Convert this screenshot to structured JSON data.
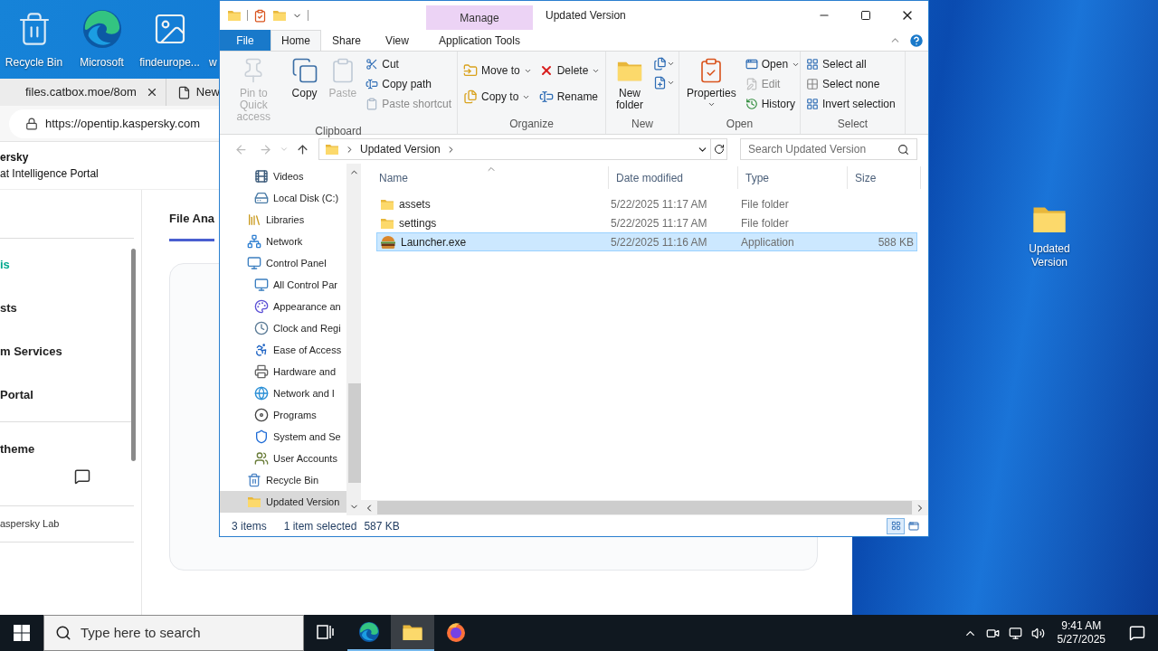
{
  "desktop_icons": [
    {
      "label": "Recycle Bin",
      "kind": "recycle"
    },
    {
      "label": "Microsoft",
      "kind": "edge"
    },
    {
      "label": "findeurope...",
      "kind": "image"
    },
    {
      "label": "w",
      "kind": "hidden"
    }
  ],
  "desktop_icons_right": [
    {
      "label": "Updated Version",
      "kind": "folder"
    }
  ],
  "browser": {
    "tabs": [
      {
        "label": "files.catbox.moe/8om",
        "kind": "page"
      },
      {
        "label": "New",
        "kind": "new"
      }
    ],
    "address": "https://opentip.kaspersky.com",
    "brand": "ersky",
    "subtitle": "at Intelligence Portal",
    "sidebar": [
      {
        "label": "is",
        "selected": true
      },
      {
        "label": "sts",
        "selected": false
      },
      {
        "label": "m Services",
        "selected": false
      },
      {
        "label": "Portal",
        "selected": false
      }
    ],
    "theme_label": "theme",
    "footer": "aspersky Lab",
    "page_tab": "File Ana"
  },
  "explorer": {
    "title": "Updated Version",
    "contextual": {
      "group": "Manage",
      "tab": "Application Tools"
    },
    "tabs": [
      {
        "label": "File",
        "kind": "file",
        "selected": false
      },
      {
        "label": "Home",
        "kind": "tab",
        "selected": true
      },
      {
        "label": "Share",
        "kind": "tab",
        "selected": false
      },
      {
        "label": "View",
        "kind": "tab",
        "selected": false
      }
    ],
    "ribbon": [
      {
        "label": "Clipboard",
        "commands": [
          {
            "label": "Pin to Quick access",
            "disabled": true
          },
          {
            "label": "Copy",
            "disabled": false
          },
          {
            "label": "Paste",
            "disabled": true
          },
          {
            "label": "Cut",
            "disabled": false
          },
          {
            "label": "Copy path",
            "disabled": false
          },
          {
            "label": "Paste shortcut",
            "disabled": true
          }
        ]
      },
      {
        "label": "Organize",
        "commands": [
          {
            "label": "Move to",
            "disabled": false
          },
          {
            "label": "Copy to",
            "disabled": false
          },
          {
            "label": "Delete",
            "disabled": false
          },
          {
            "label": "Rename",
            "disabled": false
          }
        ]
      },
      {
        "label": "New",
        "commands": [
          {
            "label": "New folder",
            "disabled": false
          }
        ]
      },
      {
        "label": "Open",
        "commands": [
          {
            "label": "Properties",
            "disabled": false
          },
          {
            "label": "Open",
            "disabled": false
          },
          {
            "label": "Edit",
            "disabled": true
          },
          {
            "label": "History",
            "disabled": false
          }
        ]
      },
      {
        "label": "Select",
        "commands": [
          {
            "label": "Select all",
            "disabled": false
          },
          {
            "label": "Select none",
            "disabled": false
          },
          {
            "label": "Invert selection",
            "disabled": false
          }
        ]
      }
    ],
    "path": [
      "Updated Version"
    ],
    "search_placeholder": "Search Updated Version",
    "nav_pane": {
      "scrolled_children": [
        {
          "label": "Videos",
          "kind": "videos",
          "selected": false
        },
        {
          "label": "Local Disk (C:)",
          "kind": "disk",
          "selected": false
        }
      ],
      "items": [
        {
          "label": "Libraries",
          "kind": "library",
          "selected": false
        },
        {
          "label": "Network",
          "kind": "network",
          "selected": false
        },
        {
          "label": "Control Panel",
          "kind": "control",
          "selected": false,
          "children": [
            {
              "label": "All Control Par",
              "kind": "control",
              "selected": false
            },
            {
              "label": "Appearance an",
              "kind": "appearance",
              "selected": false
            },
            {
              "label": "Clock and Regi",
              "kind": "clock",
              "selected": false
            },
            {
              "label": "Ease of Access",
              "kind": "access",
              "selected": false
            },
            {
              "label": "Hardware and",
              "kind": "hardware",
              "selected": false
            },
            {
              "label": "Network and I",
              "kind": "netcenter",
              "selected": false
            },
            {
              "label": "Programs",
              "kind": "programs",
              "selected": false
            },
            {
              "label": "System and Se",
              "kind": "system",
              "selected": false
            },
            {
              "label": "User Accounts",
              "kind": "users",
              "selected": false
            }
          ]
        },
        {
          "label": "Recycle Bin",
          "kind": "recycle",
          "selected": false
        },
        {
          "label": "Updated Version",
          "kind": "folder",
          "selected": true
        }
      ]
    },
    "columns": [
      "Name",
      "Date modified",
      "Type",
      "Size"
    ],
    "rows": [
      {
        "name": "assets",
        "date": "5/22/2025 11:17 AM",
        "type": "File folder",
        "kind": "folder",
        "selected": false
      },
      {
        "name": "settings",
        "date": "5/22/2025 11:17 AM",
        "type": "File folder",
        "kind": "folder",
        "selected": false
      },
      {
        "name": "Launcher.exe",
        "date": "5/22/2025 11:16 AM",
        "type": "Application",
        "size": "588 KB",
        "kind": "app",
        "selected": true
      }
    ],
    "status": {
      "count": "3 items",
      "selection": "1 item selected",
      "selection_size": "587 KB"
    }
  },
  "taskbar": {
    "search_placeholder": "Type here to search",
    "apps": [
      {
        "kind": "taskview",
        "selected": false,
        "running": false
      },
      {
        "kind": "edge",
        "selected": false,
        "running": true
      },
      {
        "kind": "explorer",
        "selected": true,
        "running": true
      },
      {
        "kind": "firefox",
        "selected": false,
        "running": false
      }
    ],
    "time": "9:41 AM",
    "date": "5/27/2025"
  }
}
